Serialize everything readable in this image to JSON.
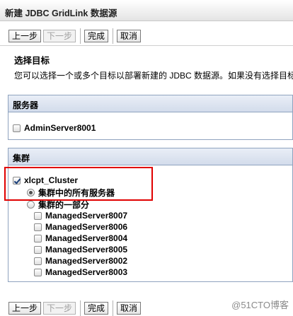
{
  "window": {
    "title": "新建 JDBC GridLink 数据源"
  },
  "toolbar": {
    "prev": "上一步",
    "next": "下一步",
    "finish": "完成",
    "cancel": "取消"
  },
  "section": {
    "title": "选择目标",
    "description": "您可以选择一个或多个目标以部署新建的 JDBC 数据源。如果没有选择目标"
  },
  "servers": {
    "header": "服务器",
    "items": [
      {
        "label": "AdminServer8001",
        "checked": false
      }
    ]
  },
  "clusters": {
    "header": "集群",
    "cluster": {
      "label": "xlcpt_Cluster",
      "checked": true
    },
    "options": [
      {
        "label": "集群中的所有服务器",
        "selected": true
      },
      {
        "label": "集群的一部分",
        "selected": false
      }
    ],
    "members": [
      {
        "label": "ManagedServer8007",
        "checked": false
      },
      {
        "label": "ManagedServer8006",
        "checked": false
      },
      {
        "label": "ManagedServer8004",
        "checked": false
      },
      {
        "label": "ManagedServer8005",
        "checked": false
      },
      {
        "label": "ManagedServer8002",
        "checked": false
      },
      {
        "label": "ManagedServer8003",
        "checked": false
      }
    ]
  },
  "watermark": {
    "text": "@51CTO博客"
  },
  "colors": {
    "highlight": "#e00000",
    "panel_border": "#8fa3bf"
  }
}
